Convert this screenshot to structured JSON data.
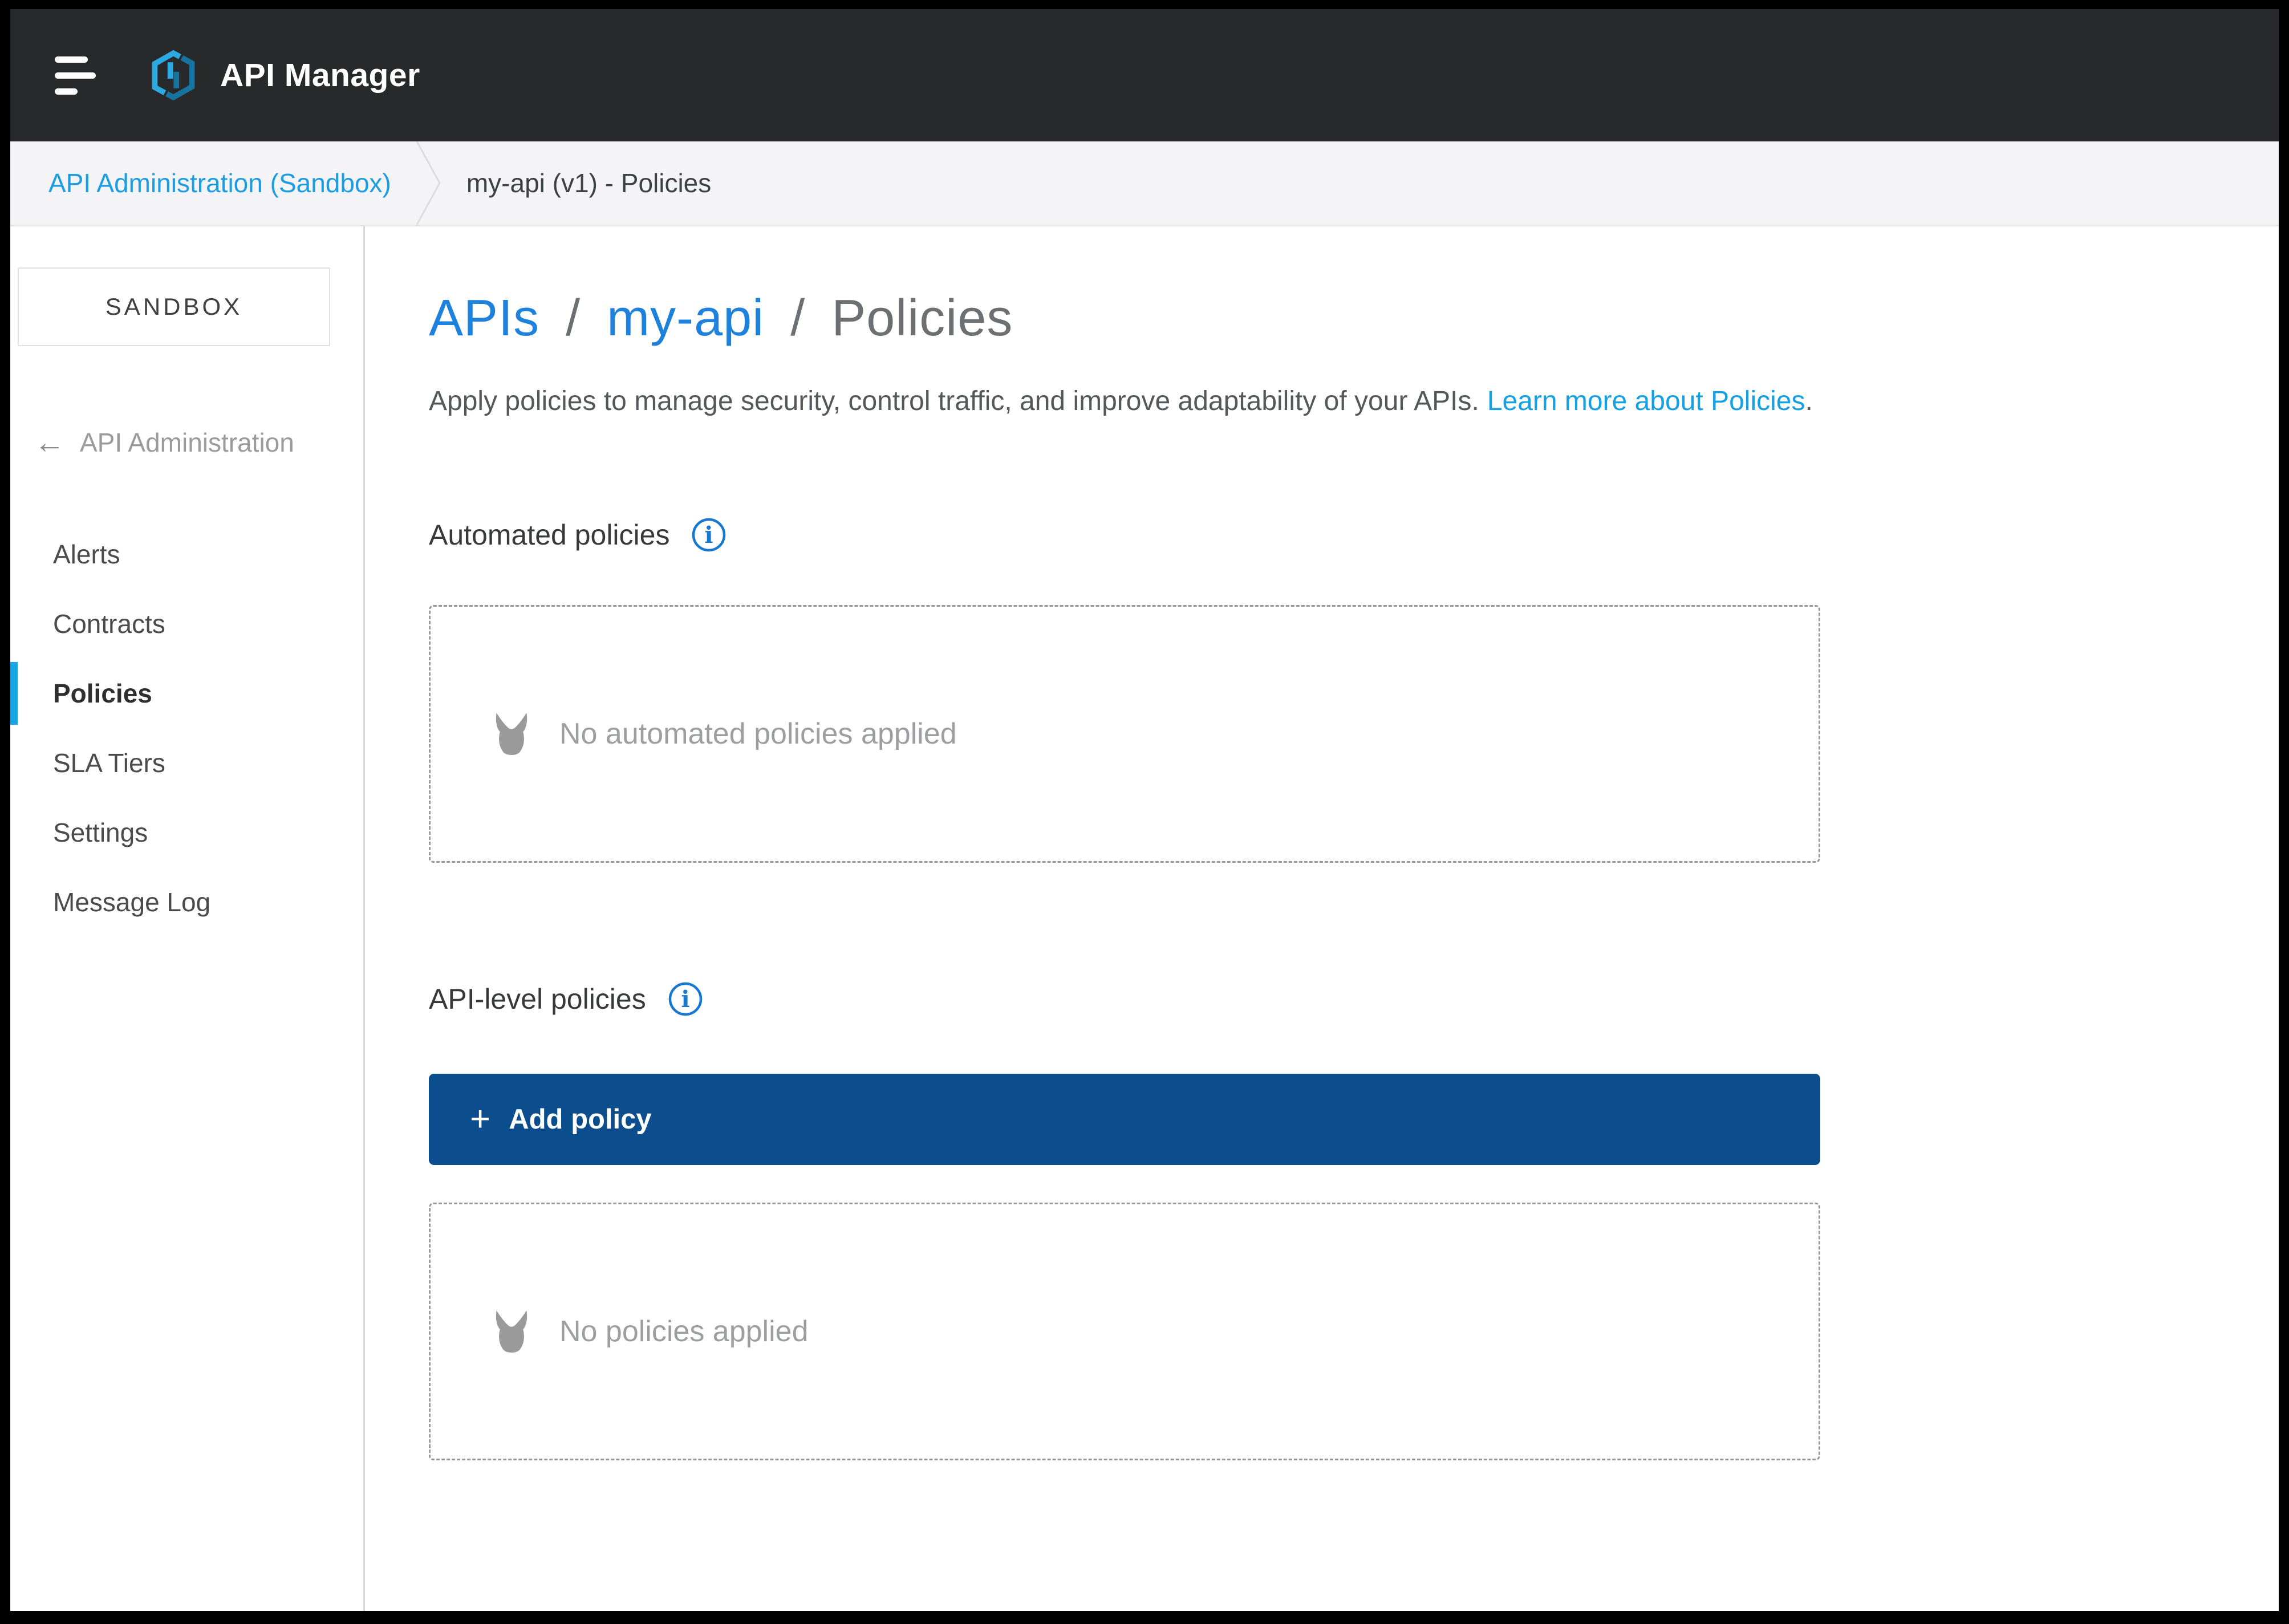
{
  "topbar": {
    "title": "API Manager"
  },
  "breadcrumb": {
    "items": [
      {
        "label": "API Administration (Sandbox)"
      },
      {
        "label": "my-api (v1) - Policies"
      }
    ]
  },
  "sidebar": {
    "environment_label": "SANDBOX",
    "back_label": "API Administration",
    "items": [
      {
        "label": "Alerts"
      },
      {
        "label": "Contracts"
      },
      {
        "label": "Policies",
        "active": true
      },
      {
        "label": "SLA Tiers"
      },
      {
        "label": "Settings"
      },
      {
        "label": "Message Log"
      }
    ],
    "active_item": "Policies"
  },
  "main": {
    "title": {
      "parts": [
        "APIs",
        "my-api",
        "Policies"
      ],
      "separator": "/"
    },
    "description": "Apply policies to manage security, control traffic, and improve adaptability of your APIs.",
    "learn_more_label": "Learn more about Policies",
    "learn_more_suffix": ".",
    "sections": {
      "automated": {
        "label": "Automated policies",
        "empty_message": "No automated policies applied"
      },
      "api_level": {
        "label": "API-level policies",
        "empty_message": "No policies applied",
        "add_button_label": "Add policy"
      }
    }
  },
  "icons": {
    "back_arrow": "←",
    "plus": "+",
    "info_glyph": "i"
  },
  "colors": {
    "topbar_bg": "#27292b",
    "accent_blue": "#15a5e2",
    "link_blue": "#14a0e3",
    "heading_link_blue": "#1e82dd",
    "button_navy": "#0b4d8d",
    "empty_gray": "#9c9ea1",
    "logo_light_blue": "#2ca9e0",
    "logo_dark_blue": "#17739f"
  }
}
